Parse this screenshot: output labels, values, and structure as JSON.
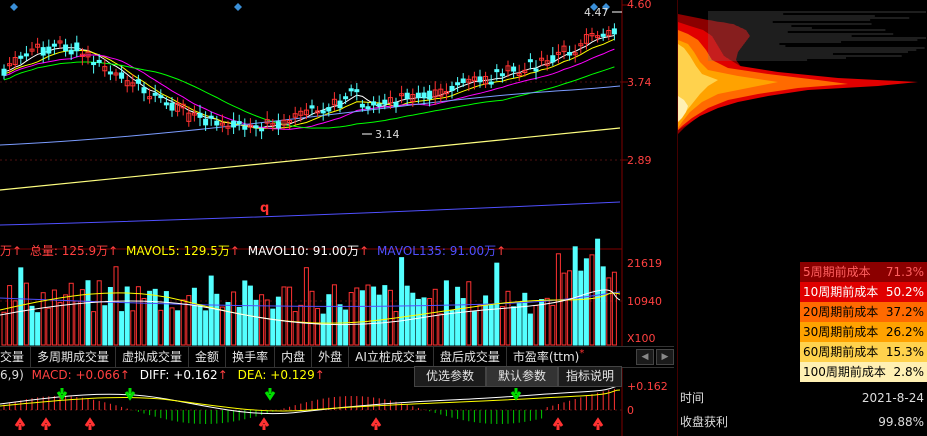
{
  "price_axis": {
    "top": "4.60",
    "mid": "3.74",
    "low": "2.89"
  },
  "annotations": {
    "high": "4.47",
    "low": "3.14",
    "q_mark": "q"
  },
  "volume_legend": {
    "unit_prefix": "万",
    "total_label": "总量:",
    "total_value": "125.9万",
    "mavol5_label": "MAVOL5:",
    "mavol5_value": "129.5万",
    "mavol10_label": "MAVOL10:",
    "mavol10_value": "91.00万",
    "mavol135_label": "MAVOL135:",
    "mavol135_value": "91.00万",
    "up_arrow": "↑"
  },
  "volume_axis": {
    "top": "21619",
    "mid": "10940",
    "unit": "X100"
  },
  "tabs": [
    "交量",
    "多周期成交量",
    "虚拟成交量",
    "金额",
    "换手率",
    "内盘",
    "外盘",
    "AI立桩成交量",
    "盘后成交量",
    "市盈率(ttm)"
  ],
  "tab_badge": "*",
  "macd_legend": {
    "params": "6,9)",
    "macd_label": "MACD:",
    "macd_value": "+0.066",
    "diff_label": "DIFF:",
    "diff_value": "+0.162",
    "dea_label": "DEA:",
    "dea_value": "+0.129",
    "up_arrow": "↑"
  },
  "macd_buttons": {
    "optimize": "优选参数",
    "default": "默认参数",
    "help": "指标说明"
  },
  "macd_axis": {
    "top": "+0.162",
    "zero": "0"
  },
  "cost_table": [
    {
      "label": "5周期前成本",
      "value": "71.3%",
      "bg": "#8b0000",
      "fg": "#ff6060"
    },
    {
      "label": "10周期前成本",
      "value": "50.2%",
      "bg": "#e00000",
      "fg": "#ffffff"
    },
    {
      "label": "20周期前成本",
      "value": "37.2%",
      "bg": "#ff6a00",
      "fg": "#000000"
    },
    {
      "label": "30周期前成本",
      "value": "26.2%",
      "bg": "#ffa200",
      "fg": "#000000"
    },
    {
      "label": "60周期前成本",
      "value": "15.3%",
      "bg": "#ffd24d",
      "fg": "#000000"
    },
    {
      "label": "100周期前成本",
      "value": "2.8%",
      "bg": "#fff0b3",
      "fg": "#000000"
    }
  ],
  "info": {
    "time_label": "时间",
    "time_value": "2021-8-24",
    "profit_label": "收盘获利",
    "profit_value": "99.88%"
  },
  "colors": {
    "up": "#ff3232",
    "down": "#54ffff",
    "ma5": "#ffffff",
    "ma10": "#ffff00",
    "ma20": "#ff00ff",
    "ma30": "#00ff00",
    "ma60": "#7b9cff",
    "ma120": "#ffff80",
    "mavol135": "#5050ff"
  }
}
